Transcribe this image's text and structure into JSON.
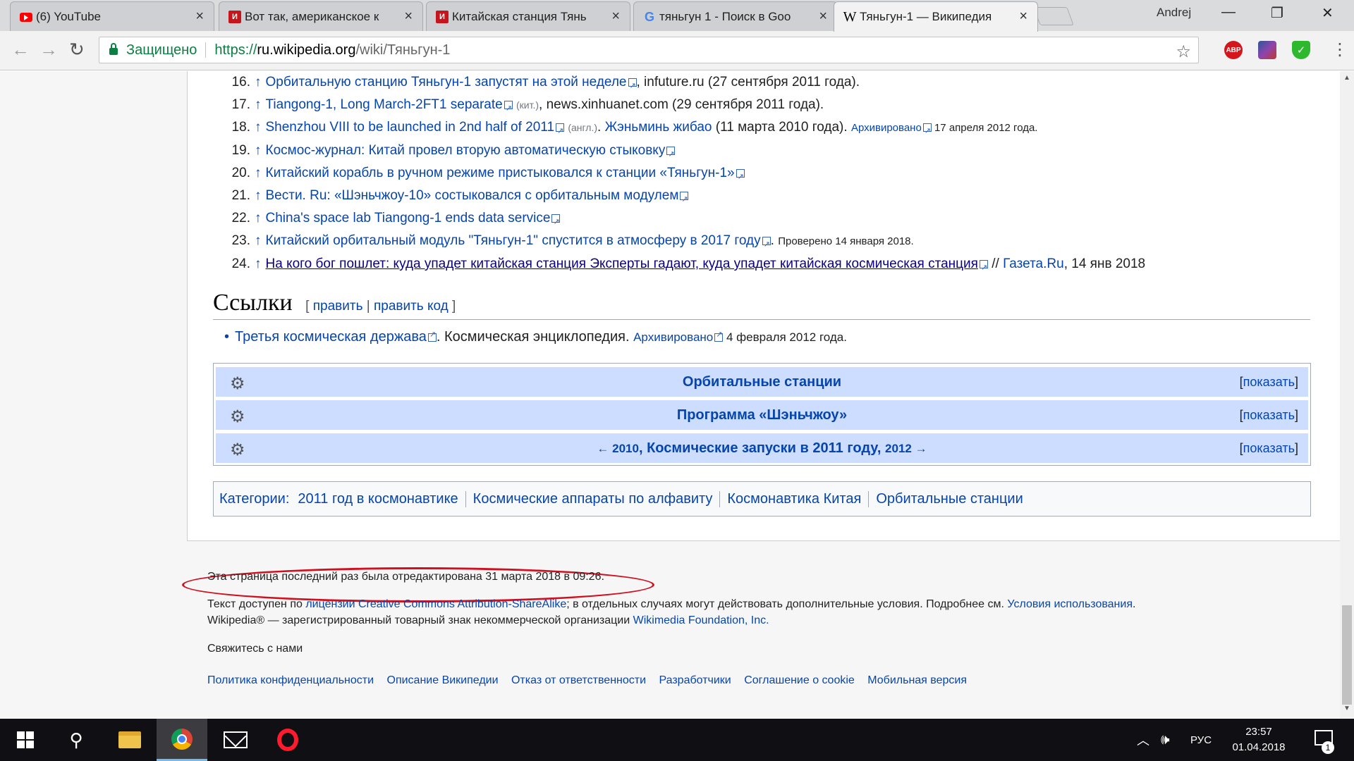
{
  "browser": {
    "tabs": [
      {
        "title": "(6) YouTube",
        "favicon": "youtube-icon"
      },
      {
        "title": "Вот так, американское к",
        "favicon": "news-icon"
      },
      {
        "title": "Китайская станция Тянь",
        "favicon": "news-icon"
      },
      {
        "title": "тяньгун 1 - Поиск в Goo",
        "favicon": "google-icon"
      },
      {
        "title": "Тяньгун-1 — Википедия",
        "favicon": "wikipedia-icon",
        "active": true
      }
    ],
    "profile": "Andrej",
    "secure_label": "Защищено",
    "url_proto": "https://",
    "url_host": "ru.wikipedia.org",
    "url_path": "/wiki/Тяньгун-1",
    "abp_label": "ABP"
  },
  "references": [
    {
      "num": "16.",
      "link": "Орбитальную станцию Тяньгун-1 запустят на этой неделе",
      "rest": ", infuture.ru (27 сентября 2011 года)."
    },
    {
      "num": "17.",
      "link": "Tiangong-1, Long March-2FT1 separate",
      "lang": "(кит.)",
      "rest": ", news.xinhuanet.com (29 сентября 2011 года)."
    },
    {
      "num": "18.",
      "link": "Shenzhou VIII to be launched in 2nd half of 2011",
      "lang": "(англ.)",
      "rest": ". ",
      "link2": "Жэньминь жибао",
      "rest2": " (11 марта 2010 года). ",
      "archived": "Архивировано",
      "archived_date": " 17 апреля 2012 года."
    },
    {
      "num": "19.",
      "link": "Космос-журнал: Китай провел вторую автоматическую стыковку",
      "rest": ""
    },
    {
      "num": "20.",
      "link": "Китайский корабль в ручном режиме пристыковался к станции «Тяньгун-1»",
      "rest": ""
    },
    {
      "num": "21.",
      "link": "Вести. Ru: «Шэньчжоу-10» состыковался с орбитальным модулем",
      "rest": ""
    },
    {
      "num": "22.",
      "link": "China's space lab Tiangong-1 ends data service",
      "rest": ""
    },
    {
      "num": "23.",
      "link": "Китайский орбитальный модуль \"Тяньгун-1\" спустится в атмосферу в 2017 году",
      "rest": ". ",
      "checked": "Проверено 14 января 2018."
    },
    {
      "num": "24.",
      "link": "На кого бог пошлет: куда упадет китайская станция Эксперты гадают, куда упадет китайская космическая станция",
      "rest": " // ",
      "link2": "Газета.Ru",
      "rest2": ", 14 янв 2018"
    }
  ],
  "links_section": {
    "heading": "Ссылки",
    "edit": "править",
    "edit_code": "править код",
    "item_link": "Третья космическая держава",
    "item_rest": ". Космическая энциклопедия. ",
    "item_archived": "Архивировано",
    "item_date": " 4 февраля 2012 года."
  },
  "navboxes": [
    {
      "title": "Орбитальные станции",
      "show": "показать"
    },
    {
      "title": "Программа «Шэньчжоу»",
      "show": "показать"
    },
    {
      "prev": "← 2010",
      "title": "Космические запуски в 2011 году",
      "next": "2012 →",
      "show": "показать"
    }
  ],
  "categories": {
    "label": "Категории:",
    "items": [
      "2011 год в космонавтике",
      "Космические аппараты по алфавиту",
      "Космонавтика Китая",
      "Орбитальные станции"
    ]
  },
  "footer": {
    "last_edited": "Эта страница последний раз была отредактирована 31 марта 2018 в 09:26.",
    "license_pre": "Текст доступен по ",
    "license_link": "лицензии Creative Commons Attribution-ShareAlike",
    "license_mid": "; в отдельных случаях могут действовать дополнительные условия. Подробнее см. ",
    "terms_link": "Условия использования",
    "license_end": ".",
    "trademark_pre": "Wikipedia® — зарегистрированный товарный знак некоммерческой организации ",
    "trademark_link": "Wikimedia Foundation, Inc.",
    "contact": "Свяжитесь с нами",
    "links": [
      "Политика конфиденциальности",
      "Описание Википедии",
      "Отказ от ответственности",
      "Разработчики",
      "Соглашение о cookie",
      "Мобильная версия"
    ]
  },
  "taskbar": {
    "lang": "РУС",
    "time": "23:57",
    "date": "01.04.2018",
    "notifications": "1"
  }
}
